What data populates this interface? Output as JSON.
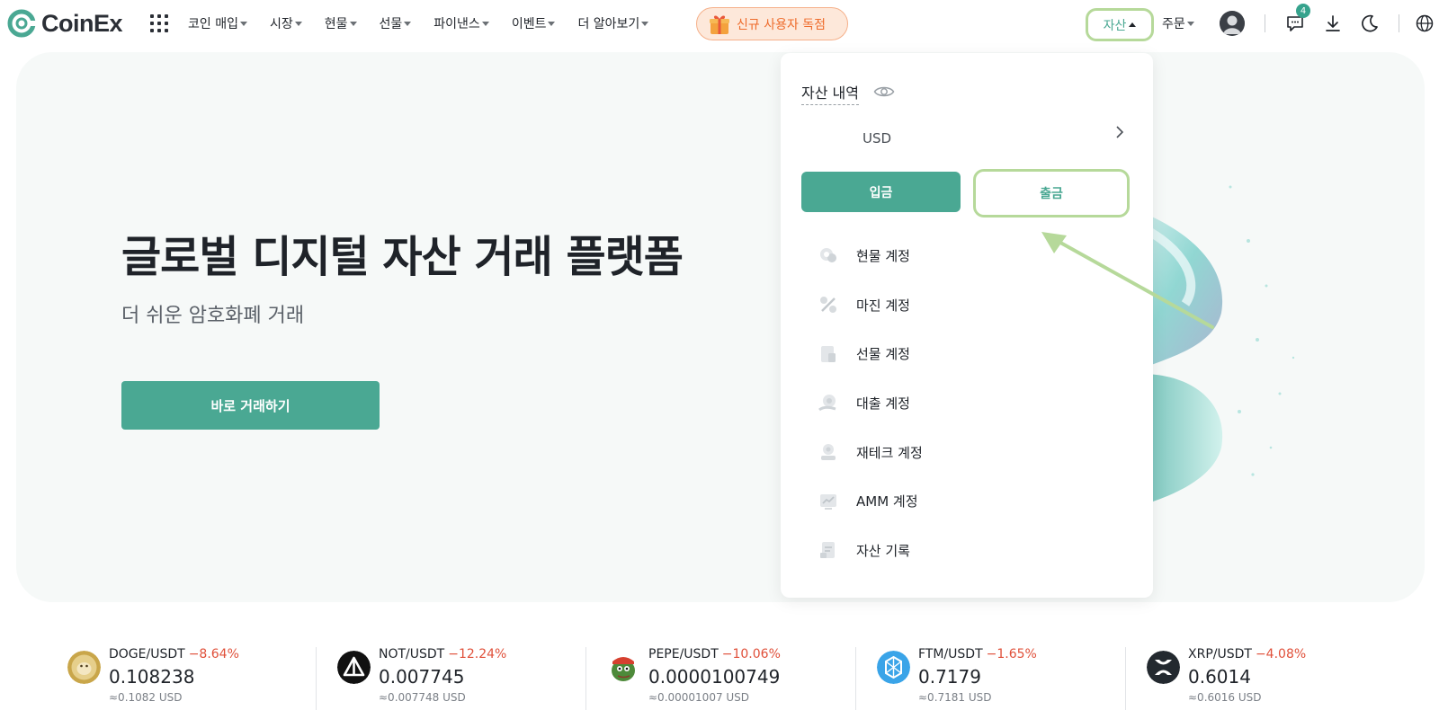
{
  "brand": {
    "name": "CoinEx",
    "color": "#4aa893"
  },
  "nav": {
    "items": [
      {
        "label": "코인 매입"
      },
      {
        "label": "시장"
      },
      {
        "label": "현물"
      },
      {
        "label": "선물"
      },
      {
        "label": "파이낸스"
      },
      {
        "label": "이벤트"
      },
      {
        "label": "더 알아보기"
      }
    ],
    "promo_label": "신규 사용자 독점",
    "assets_label": "자산",
    "orders_label": "주문",
    "notification_count": "4"
  },
  "hero": {
    "title": "글로벌 디지털 자산 거래 플랫폼",
    "subtitle": "더 쉬운 암호화폐 거래",
    "cta_label": "바로 거래하기"
  },
  "asset_menu": {
    "title": "자산 내역",
    "currency": "USD",
    "deposit_label": "입금",
    "withdraw_label": "출금",
    "items": [
      {
        "label": "현물 계정",
        "icon": "spot-account-icon"
      },
      {
        "label": "마진 계정",
        "icon": "margin-account-icon"
      },
      {
        "label": "선물 계정",
        "icon": "futures-account-icon"
      },
      {
        "label": "대출 계정",
        "icon": "loan-account-icon"
      },
      {
        "label": "재테크 계정",
        "icon": "finance-account-icon"
      },
      {
        "label": "AMM 계정",
        "icon": "amm-account-icon"
      },
      {
        "label": "자산 기록",
        "icon": "asset-history-icon"
      }
    ]
  },
  "tickers": [
    {
      "pair": "DOGE/USDT",
      "change": "−8.64%",
      "price": "0.108238",
      "usd": "≈0.1082 USD",
      "icon": "doge-icon",
      "color": "#c9a64a"
    },
    {
      "pair": "NOT/USDT",
      "change": "−12.24%",
      "price": "0.007745",
      "usd": "≈0.007748 USD",
      "icon": "not-icon",
      "color": "#111111"
    },
    {
      "pair": "PEPE/USDT",
      "change": "−10.06%",
      "price": "0.0000100749",
      "usd": "≈0.00001007 USD",
      "icon": "pepe-icon",
      "color": "#4d8a3a"
    },
    {
      "pair": "FTM/USDT",
      "change": "−1.65%",
      "price": "0.7179",
      "usd": "≈0.7181 USD",
      "icon": "ftm-icon",
      "color": "#3aa4e8"
    },
    {
      "pair": "XRP/USDT",
      "change": "−4.08%",
      "price": "0.6014",
      "usd": "≈0.6016 USD",
      "icon": "xrp-icon",
      "color": "#23292f"
    }
  ]
}
